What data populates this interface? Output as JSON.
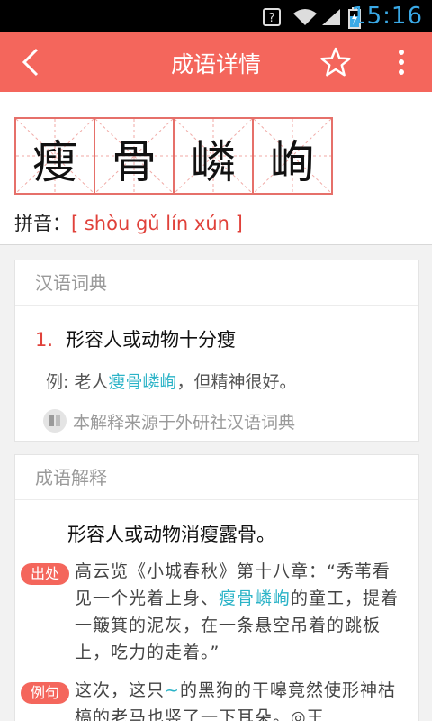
{
  "status_bar": {
    "time": "15:16"
  },
  "app_bar": {
    "title": "成语详情"
  },
  "idiom": {
    "chars": [
      "瘦",
      "骨",
      "嶙",
      "峋"
    ],
    "pinyin_label": "拼音：",
    "pinyin": "[ shòu gǔ lín xún ]"
  },
  "dictionary": {
    "title": "汉语词典",
    "def_num": "1.",
    "definition": "形容人或动物十分瘦",
    "example_prefix": "例: 老人",
    "example_highlight": "瘦骨嶙峋",
    "example_suffix": "，但精神很好。",
    "source": "本解释来源于外研社汉语词典"
  },
  "explanation": {
    "title": "成语解释",
    "meaning": "形容人或动物消瘦露骨。",
    "origin_tag": "出处",
    "origin_part1": "高云览《小城春秋》第十八章：“秀苇看见一个光着上身、",
    "origin_highlight": "瘦骨嶙峋",
    "origin_part2": "的童工，提着一簸箕的泥灰，在一条悬空吊着的跳板上，吃力的走着。”",
    "example_tag": "例句",
    "example_part1": "这次，这只",
    "example_highlight": "~",
    "example_part2": "的黑狗的干嗥竟然使形神枯槁的老马也竖了一下耳朵。",
    "example_cite": "◎王"
  },
  "colors": {
    "accent": "#f4665c",
    "pinyin": "#e0413a",
    "highlight": "#2bb3c7"
  }
}
